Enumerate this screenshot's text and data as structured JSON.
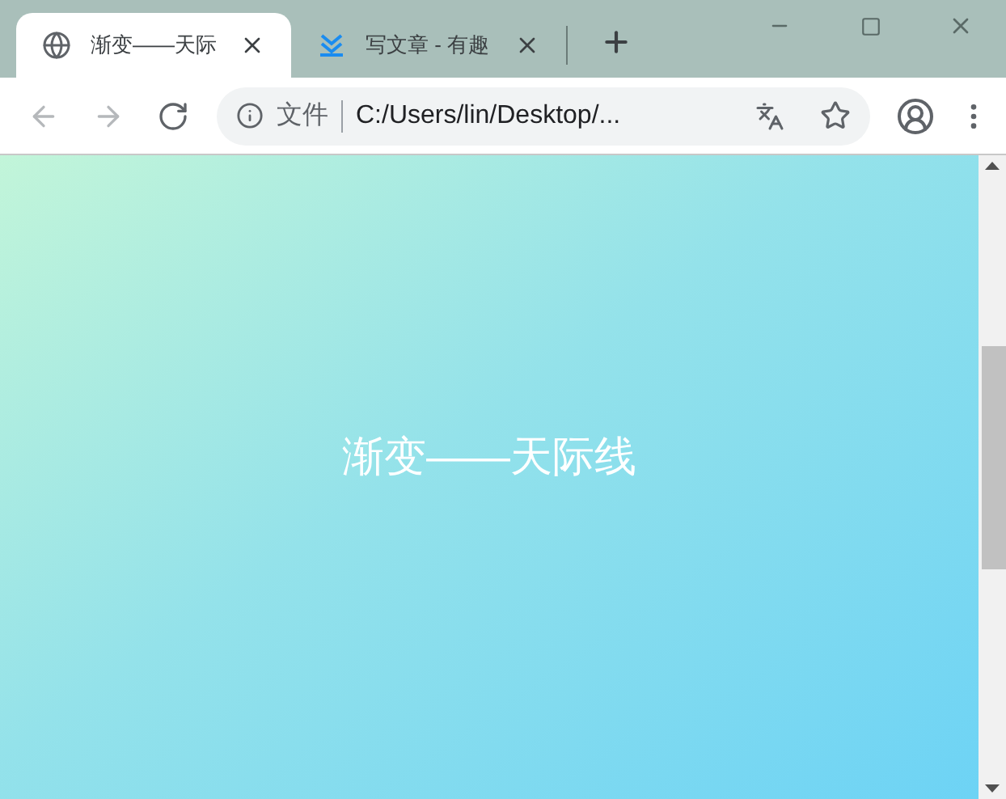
{
  "tabs": [
    {
      "title": "渐变——天际",
      "selected": true,
      "kind": "globe"
    },
    {
      "title": "写文章 - 有趣",
      "selected": false,
      "kind": "zhihu"
    }
  ],
  "nav": [
    {
      "kind": "back",
      "disabled": true
    },
    {
      "kind": "forward",
      "disabled": true
    },
    {
      "kind": "reload",
      "disabled": false
    }
  ],
  "address": {
    "security": "文件",
    "url": "C:/Users/lin/Desktop/..."
  },
  "page": {
    "heading": "渐变——天际线"
  }
}
